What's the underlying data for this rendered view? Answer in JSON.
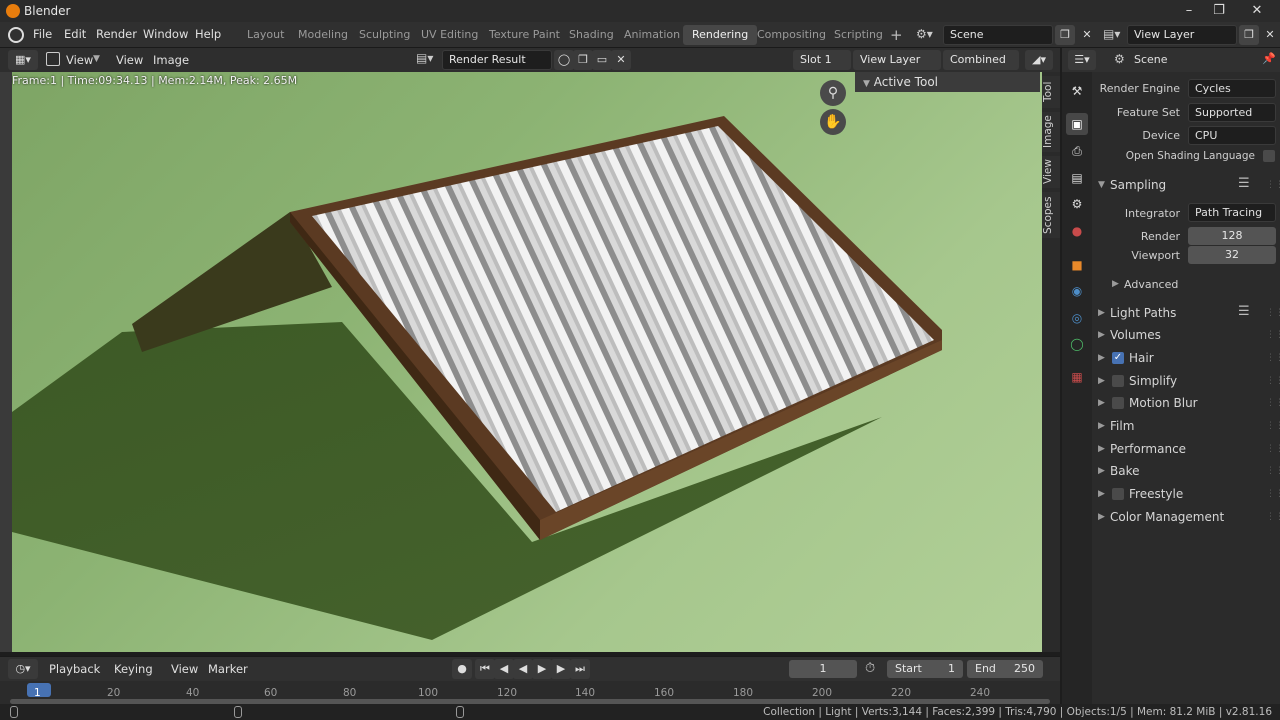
{
  "app": {
    "title": "Blender"
  },
  "menu": [
    "File",
    "Edit",
    "Render",
    "Window",
    "Help"
  ],
  "workspaces": [
    {
      "label": "Layout"
    },
    {
      "label": "Modeling"
    },
    {
      "label": "Sculpting"
    },
    {
      "label": "UV Editing"
    },
    {
      "label": "Texture Paint"
    },
    {
      "label": "Shading"
    },
    {
      "label": "Animation"
    },
    {
      "label": "Rendering",
      "active": true
    },
    {
      "label": "Compositing"
    },
    {
      "label": "Scripting"
    }
  ],
  "scene": {
    "name": "Scene",
    "view_layer": "View Layer"
  },
  "editor": {
    "view_menu": "View",
    "menu_view": "View",
    "menu_image": "Image",
    "image_name": "Render Result",
    "slot": "Slot 1",
    "layer": "View Layer",
    "pass": "Combined"
  },
  "render_info": "Frame:1 | Time:09:34.13 | Mem:2.14M, Peak: 2.65M",
  "side_tabs": [
    "Tool",
    "Image",
    "View",
    "Scopes"
  ],
  "active_tool": "Active Tool",
  "timeline": {
    "playback": "Playback",
    "keying": "Keying",
    "view": "View",
    "marker": "Marker",
    "current": "1",
    "start_label": "Start",
    "start": "1",
    "end_label": "End",
    "end": "250",
    "ticks": [
      "1",
      "20",
      "40",
      "60",
      "80",
      "100",
      "120",
      "140",
      "160",
      "180",
      "200",
      "220",
      "240"
    ]
  },
  "properties": {
    "context": "Scene",
    "render_engine_label": "Render Engine",
    "render_engine": "Cycles",
    "feature_set_label": "Feature Set",
    "feature_set": "Supported",
    "device_label": "Device",
    "device": "CPU",
    "osl_label": "Open Shading Language",
    "sampling": "Sampling",
    "integrator_label": "Integrator",
    "integrator": "Path Tracing",
    "render_label": "Render",
    "render_samples": "128",
    "viewport_label": "Viewport",
    "viewport_samples": "32",
    "advanced": "Advanced",
    "sections": [
      {
        "label": "Light Paths",
        "checkbox": null
      },
      {
        "label": "Volumes",
        "checkbox": null
      },
      {
        "label": "Hair",
        "checkbox": true
      },
      {
        "label": "Simplify",
        "checkbox": false
      },
      {
        "label": "Motion Blur",
        "checkbox": false
      },
      {
        "label": "Film",
        "checkbox": null
      },
      {
        "label": "Performance",
        "checkbox": null
      },
      {
        "label": "Bake",
        "checkbox": null
      },
      {
        "label": "Freestyle",
        "checkbox": false
      },
      {
        "label": "Color Management",
        "checkbox": null
      }
    ]
  },
  "statusbar": "Collection | Light | Verts:3,144 | Faces:2,399 | Tris:4,790 | Objects:1/5 | Mem: 81.2 MiB | v2.81.16"
}
